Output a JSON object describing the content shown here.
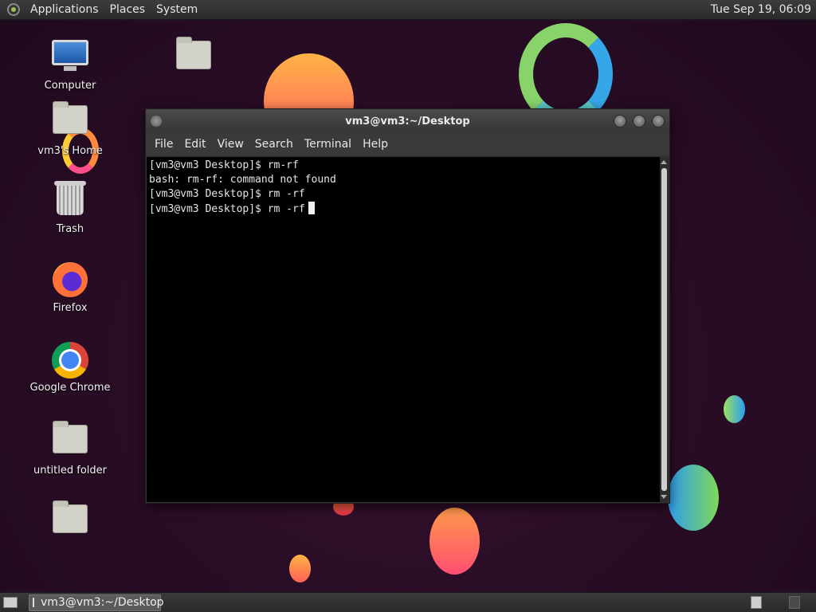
{
  "top_panel": {
    "menus": [
      "Applications",
      "Places",
      "System"
    ],
    "clock": "Tue Sep 19, 06:09"
  },
  "desktop_icons": [
    {
      "label": "Computer",
      "icon": "computer-icon"
    },
    {
      "label": "vm3's Home",
      "icon": "home-folder-icon"
    },
    {
      "label": "Trash",
      "icon": "trash-icon"
    },
    {
      "label": "Firefox",
      "icon": "firefox-icon"
    },
    {
      "label": "Google Chrome",
      "icon": "chrome-icon"
    },
    {
      "label": "untitled folder",
      "icon": "folder-icon"
    },
    {
      "label": "",
      "icon": "folder-icon"
    },
    {
      "label": "",
      "icon": "folder-icon"
    }
  ],
  "terminal": {
    "title": "vm3@vm3:~/Desktop",
    "menu": [
      "File",
      "Edit",
      "View",
      "Search",
      "Terminal",
      "Help"
    ],
    "lines": [
      "[vm3@vm3 Desktop]$ rm-rf",
      "bash: rm-rf: command not found",
      "[vm3@vm3 Desktop]$ rm -rf",
      "[vm3@vm3 Desktop]$ rm -rf"
    ]
  },
  "taskbar": {
    "task_label": "vm3@vm3:~/Desktop"
  }
}
